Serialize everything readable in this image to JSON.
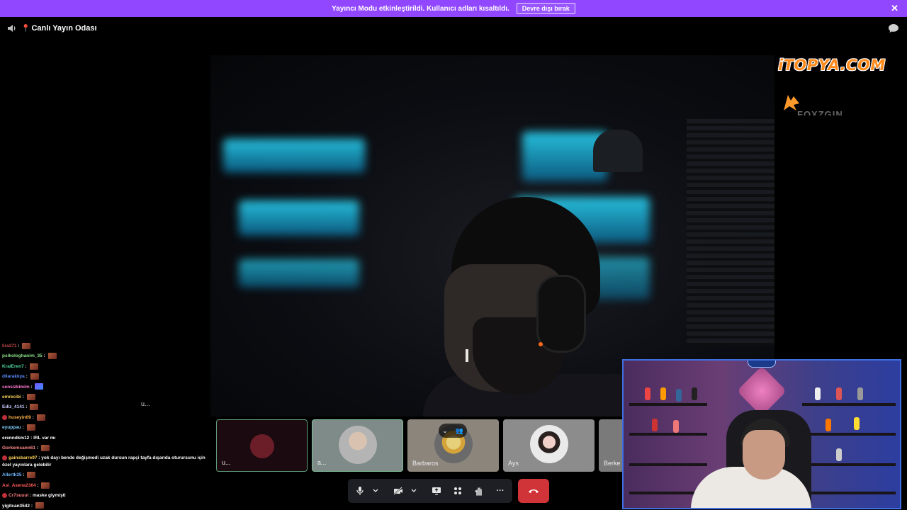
{
  "banner": {
    "text": "Yayıncı Modu etkinleştirildi. Kullanıcı adları kısaltıldı.",
    "button_label": "Devre dışı bırak",
    "close": "✕",
    "color": "#9147ff"
  },
  "header": {
    "room_title": "Canlı Yayın Odası",
    "pin_glyph": "📍"
  },
  "main_video": {
    "label": "u..."
  },
  "overlay": {
    "logo_text": "iTOPYA.COM",
    "sponsor_text": "FOXZGIN"
  },
  "chat": [
    {
      "user": "lira271",
      "text": "",
      "color": "#c14a4a",
      "badge": false
    },
    {
      "user": "psikologhanim_35",
      "text": "",
      "color": "#8be38b",
      "badge": false
    },
    {
      "user": "KralEren7",
      "text": "",
      "color": "#4fd69f",
      "badge": false
    },
    {
      "user": "dilarakkya",
      "text": "",
      "color": "#5b8cff",
      "badge": false
    },
    {
      "user": "sensizkimim",
      "text": "",
      "color": "#ff7bd6",
      "badge": false,
      "emote": "purple"
    },
    {
      "user": "emrecibi",
      "text": "",
      "color": "#ffd45a",
      "badge": false
    },
    {
      "user": "Ediz_4141",
      "text": "",
      "color": "#c9c9ff",
      "badge": false
    },
    {
      "user": "huseyin09",
      "text": "",
      "color": "#ffb347",
      "badge": true
    },
    {
      "user": "eyuppau",
      "text": "",
      "color": "#7fd0ff",
      "badge": false
    },
    {
      "user": "erenndkm12",
      "text": "IRL var mı",
      "color": "#ffffff",
      "badge": false
    },
    {
      "user": "Gorkemcann61",
      "text": "",
      "color": "#ff8c8c",
      "badge": false
    },
    {
      "user": "gainsbarre97",
      "text": "yok dayı bende değişmedi uzak dursun rapçi tayfa dışarıda oturursunu için özel yayınlara gelebilir",
      "color": "#ffd45a",
      "badge": true
    },
    {
      "user": "Allertk35",
      "text": "",
      "color": "#6fb6ff",
      "badge": false
    },
    {
      "user": "Asi_Asena2364",
      "text": "",
      "color": "#ff5a5a",
      "badge": false
    },
    {
      "user": "Cr7suuui",
      "text": "maske giymişti",
      "color": "#ff7f7f",
      "badge": true
    },
    {
      "user": "yigitcan3542",
      "text": "",
      "color": "#ffffff",
      "badge": false
    }
  ],
  "tiles": [
    {
      "name": "u...",
      "selected": true,
      "kind": "camera-off"
    },
    {
      "name": "a...",
      "selected": false,
      "kind": "avatar"
    },
    {
      "name": "Barbaros",
      "selected": false,
      "kind": "avatar"
    },
    {
      "name": "Ays",
      "selected": false,
      "kind": "avatar"
    },
    {
      "name": "Berke C",
      "selected": false,
      "kind": "avatar"
    }
  ],
  "controls": {
    "mic": "🎙",
    "camera": "camera-off-icon",
    "share": "share-screen-icon",
    "apps": "apps-icon",
    "react": "raise-hand-icon",
    "more": "···",
    "hangup": "phone-hangup-icon",
    "hangup_color": "#d13438"
  }
}
